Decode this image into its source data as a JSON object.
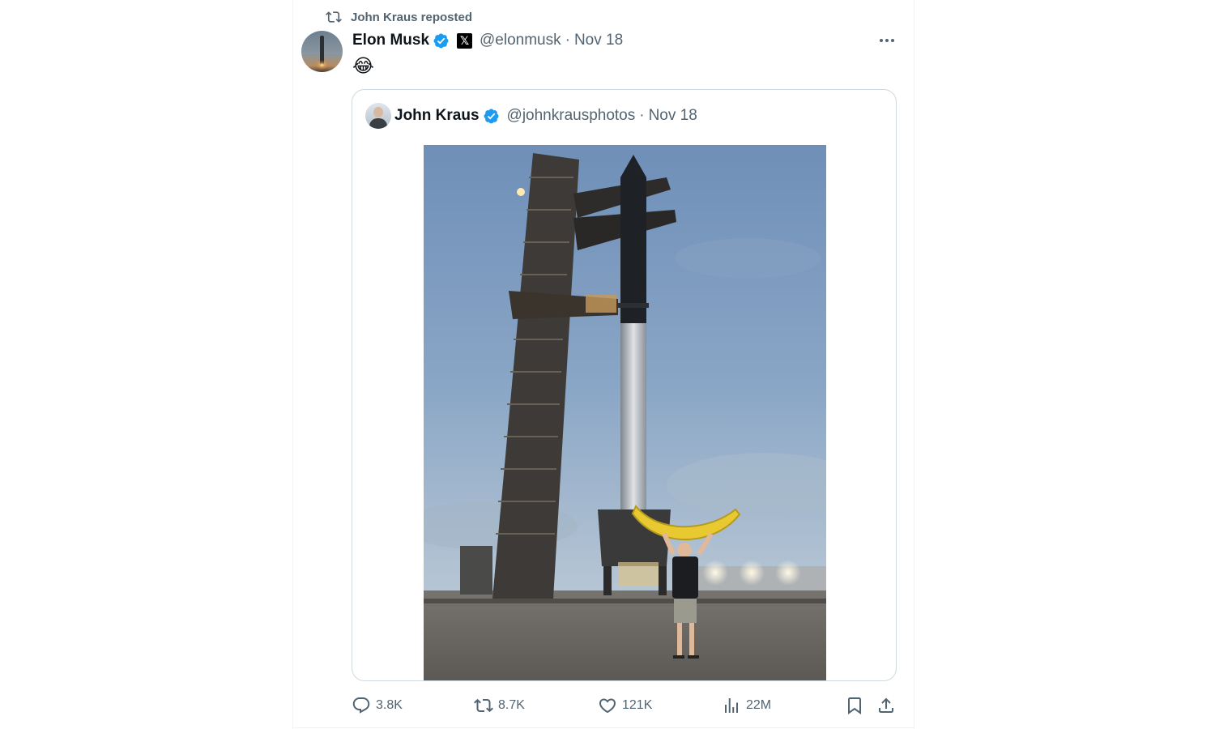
{
  "repost": {
    "text": "John Kraus reposted"
  },
  "post": {
    "author_name": "Elon Musk",
    "author_handle": "@elonmusk",
    "date_separator": "·",
    "date": "Nov 18",
    "badge_letter": "𝕏",
    "body_emoji": "😂"
  },
  "quote": {
    "author_name": "John Kraus",
    "author_handle": "@johnkrausphotos",
    "date_separator": "·",
    "date": "Nov 18"
  },
  "metrics": {
    "replies": "3.8K",
    "reposts": "8.7K",
    "likes": "121K",
    "views": "22M"
  },
  "icons": {
    "repost": "repost-icon",
    "verified": "verified-badge-icon",
    "more": "more-options-icon",
    "reply": "reply-icon",
    "like": "heart-icon",
    "views": "views-chart-icon",
    "bookmark": "bookmark-icon",
    "share": "share-icon"
  },
  "colors": {
    "verified_blue": "#1d9bf0",
    "secondary_text": "#536471",
    "primary_text": "#0f1419",
    "border": "#cfd9de"
  }
}
